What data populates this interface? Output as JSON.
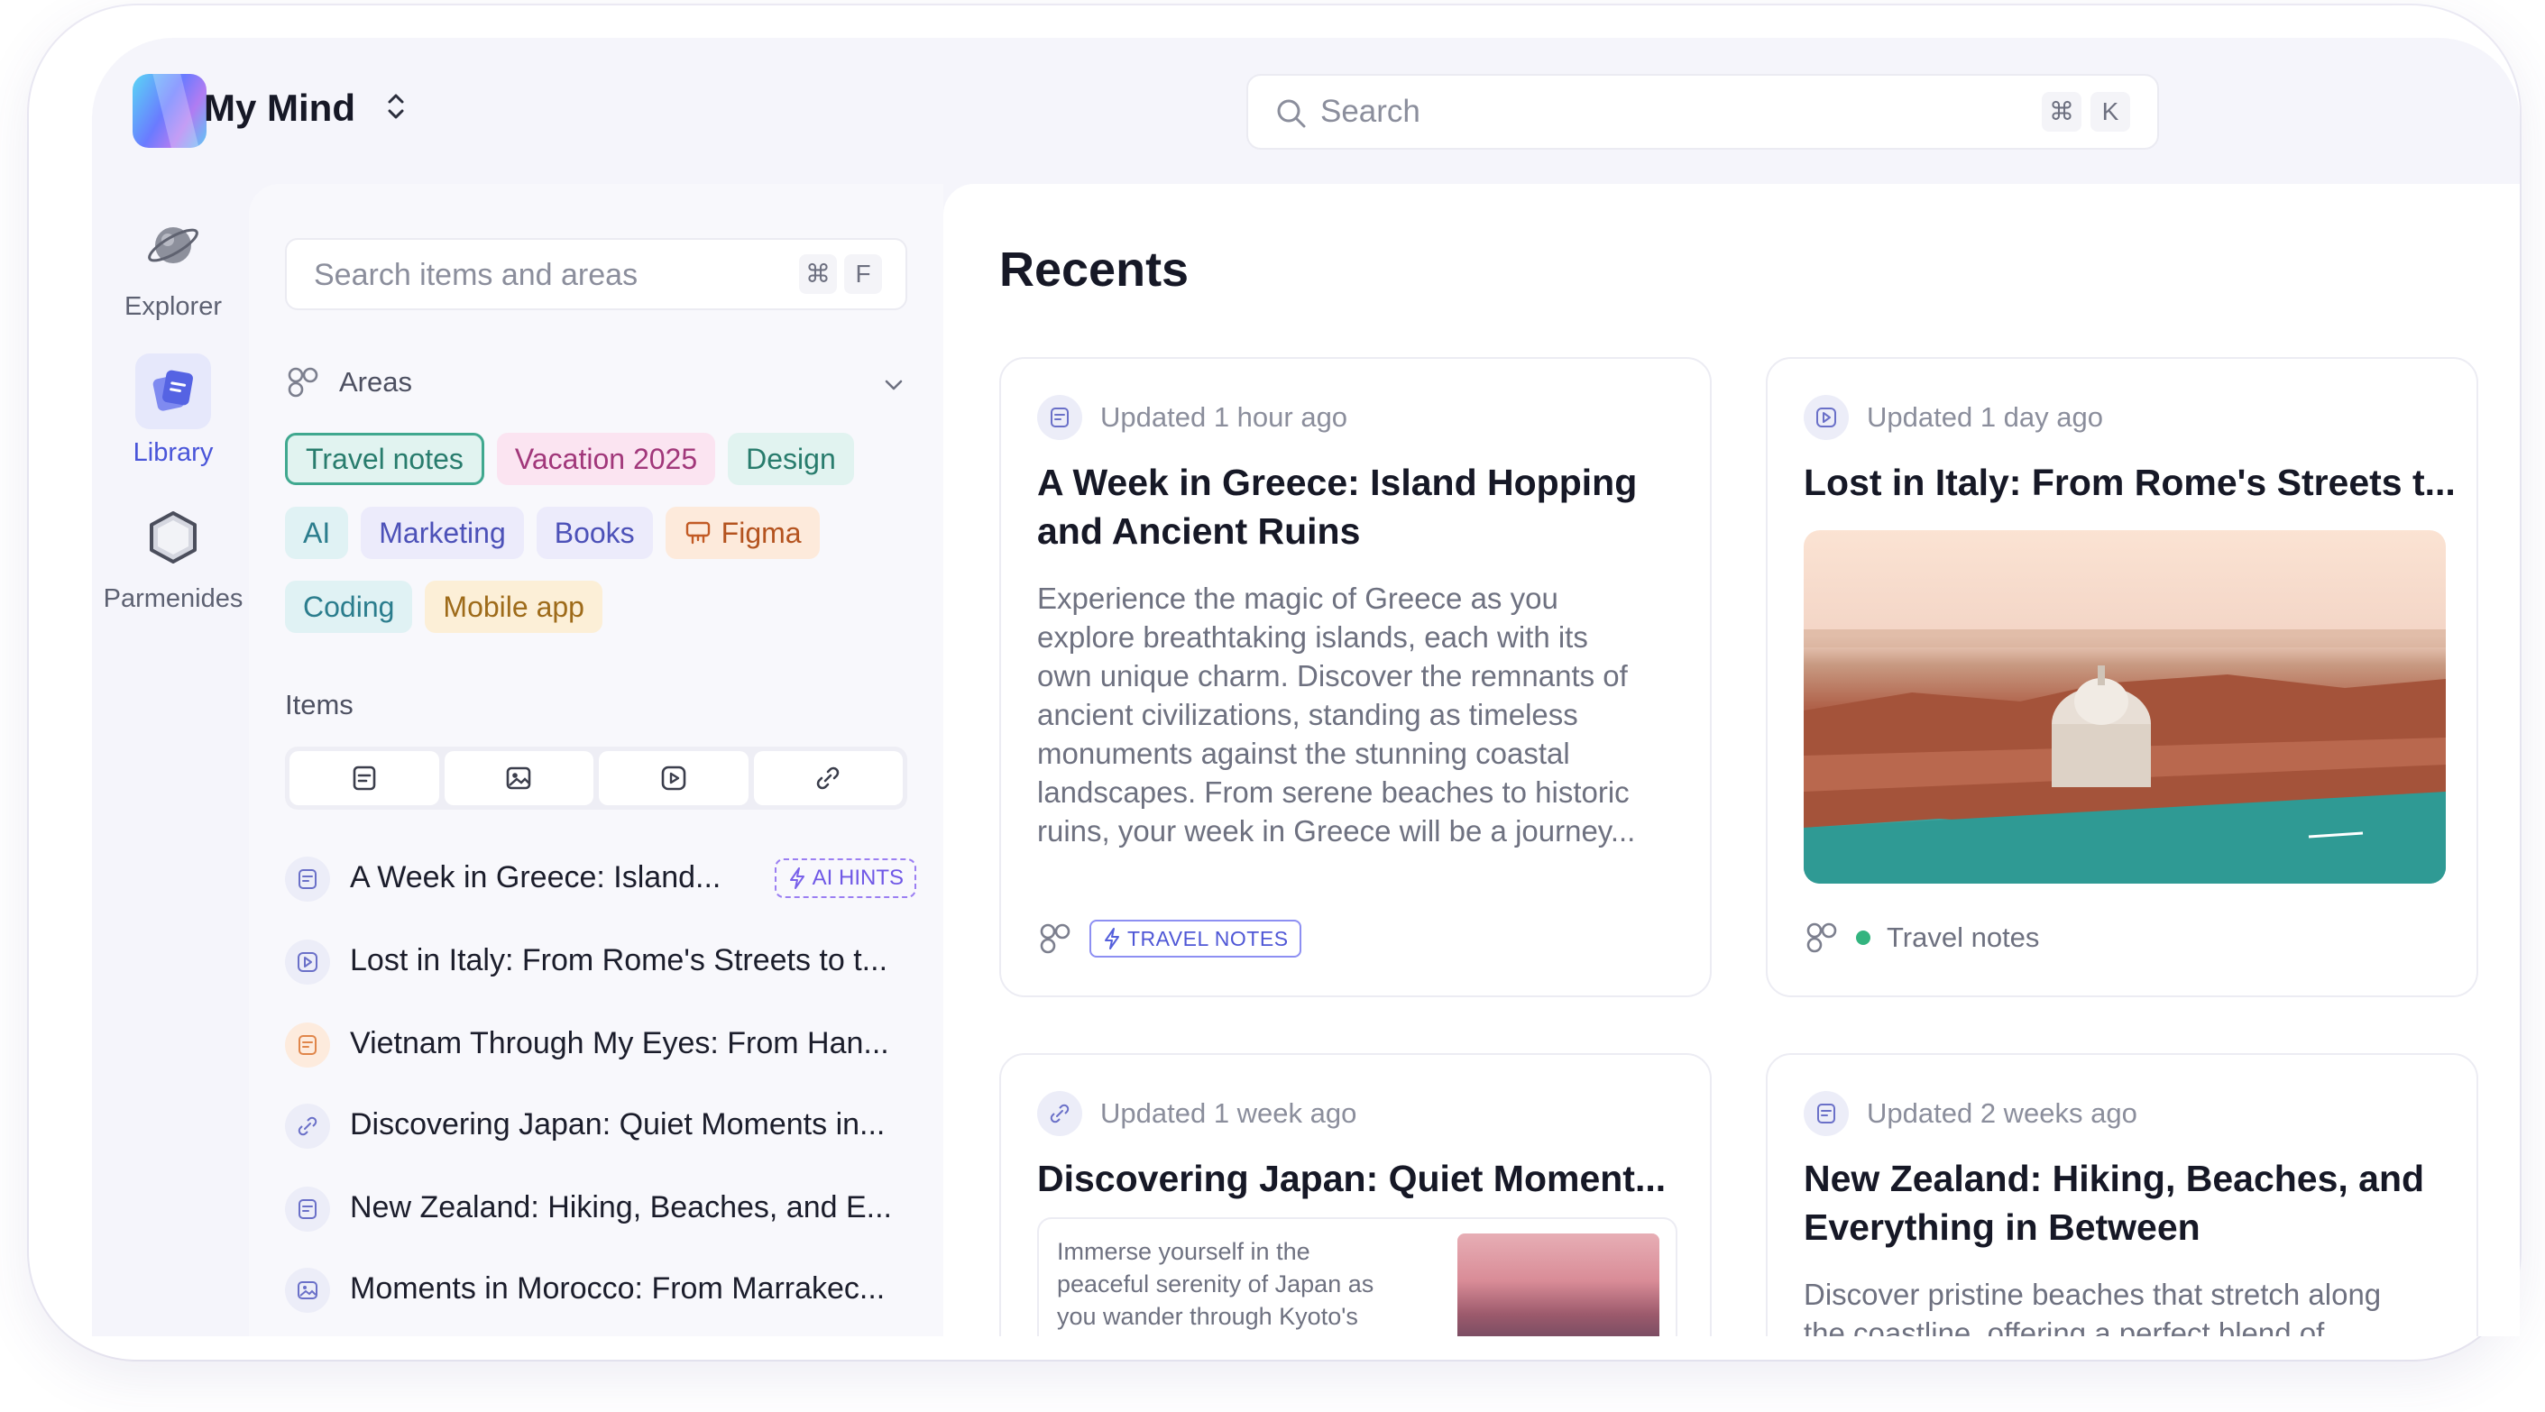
{
  "app": {
    "title": "My Mind"
  },
  "search": {
    "placeholder": "Search",
    "shortcut_mod": "⌘",
    "shortcut_key": "K"
  },
  "rail": {
    "items": [
      {
        "label": "Explorer",
        "icon": "planet-icon"
      },
      {
        "label": "Library",
        "icon": "library-icon",
        "active": true
      },
      {
        "label": "Parmenides",
        "icon": "hexagon-icon"
      }
    ]
  },
  "sidebar": {
    "search_placeholder": "Search items and areas",
    "shortcut_mod": "⌘",
    "shortcut_key": "F",
    "areas_label": "Areas",
    "tags": [
      {
        "label": "Travel notes",
        "color": "#40a88f",
        "selected": true
      },
      {
        "label": "Vacation 2025",
        "color": "#a1377a"
      },
      {
        "label": "Design",
        "color": "#287c6d"
      },
      {
        "label": "AI",
        "color": "#2b7d8d"
      },
      {
        "label": "Marketing",
        "color": "#4c51b8"
      },
      {
        "label": "Books",
        "color": "#4c51b8"
      },
      {
        "label": "Figma",
        "color": "#b4531f"
      },
      {
        "label": "Coding",
        "color": "#2b7d8d"
      },
      {
        "label": "Mobile app",
        "color": "#9e6b1a"
      }
    ],
    "items_label": "Items",
    "item_filters": [
      "note-icon",
      "image-icon",
      "video-icon",
      "link-icon"
    ],
    "items": [
      {
        "title": "A Week in Greece: Island...",
        "icon": "note-icon",
        "badge": "AI HINTS"
      },
      {
        "title": "Lost in Italy: From Rome's Streets to t...",
        "icon": "video-icon"
      },
      {
        "title": "Vietnam Through My Eyes: From Han...",
        "icon": "note-icon"
      },
      {
        "title": "Discovering Japan: Quiet Moments in...",
        "icon": "link-icon"
      },
      {
        "title": "New Zealand: Hiking, Beaches, and E...",
        "icon": "note-icon"
      },
      {
        "title": "Moments in Morocco: From Marrakec...",
        "icon": "image-icon"
      }
    ]
  },
  "main": {
    "title": "Recents",
    "cards": [
      {
        "updated": "Updated 1 hour ago",
        "title_line1": "A Week in Greece: Island Hopping",
        "title_line2": "and Ancient Ruins",
        "body": [
          "Experience the magic of Greece as you",
          "explore breathtaking islands, each with its",
          "own unique charm. Discover the remnants of",
          "ancient civilizations, standing as timeless",
          "monuments against the stunning coastal",
          "landscapes. From serene beaches to historic",
          "ruins, your week in Greece will be a journey..."
        ],
        "badge": "TRAVEL NOTES"
      },
      {
        "updated": "Updated 1 day ago",
        "title": "Lost in Italy: From Rome's Streets t...",
        "tag": "Travel notes"
      },
      {
        "updated": "Updated 1 week ago",
        "title": "Discovering Japan: Quiet Moment...",
        "preview": [
          "Immerse yourself in the",
          "peaceful serenity of Japan as",
          "you wander through Kyoto's"
        ]
      },
      {
        "updated": "Updated 2 weeks ago",
        "title_line1": "New Zealand: Hiking, Beaches, and",
        "title_line2": "Everything in Between",
        "body": [
          "Discover pristine beaches that stretch along",
          "the coastline, offering a perfect blend of"
        ]
      }
    ]
  }
}
